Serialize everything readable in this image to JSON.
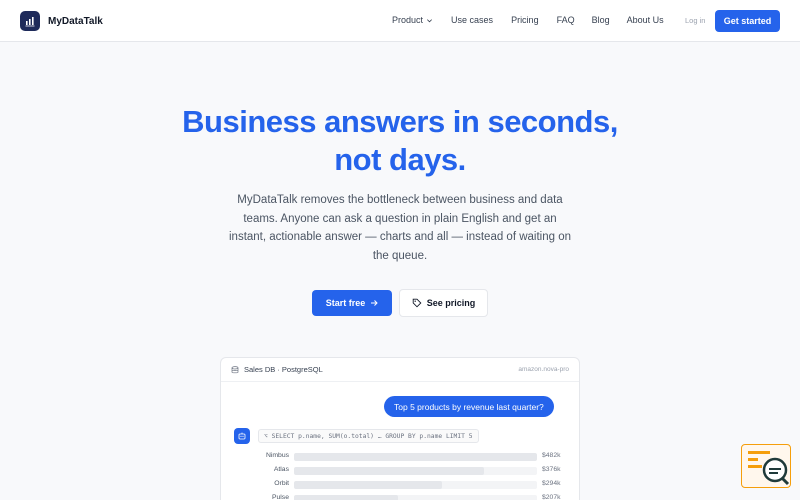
{
  "brand": {
    "name": "MyDataTalk",
    "accent": "#2563eb",
    "logo_bg": "#1e2a5a"
  },
  "nav": {
    "links": [
      {
        "label": "Product",
        "dropdown": true
      },
      {
        "label": "Use cases"
      },
      {
        "label": "Pricing"
      },
      {
        "label": "FAQ"
      },
      {
        "label": "Blog"
      },
      {
        "label": "About Us"
      }
    ],
    "login": "Log in",
    "cta": "Get started"
  },
  "hero": {
    "headline_1": "Business answers in seconds,",
    "headline_2": "not days.",
    "subtext": "MyDataTalk removes the bottleneck between business and data teams. Anyone can ask a question in plain English and get an instant, actionable answer — charts and all — instead of waiting on the queue.",
    "primary_button": "Start free",
    "secondary_button": "See pricing"
  },
  "demo": {
    "db_label": "Sales DB · PostgreSQL",
    "model": "amazon.nova-pro",
    "question": "Top 5 products by revenue last quarter?",
    "sql": "⌥ SELECT p.name, SUM(o.total) … GROUP BY p.name LIMIT 5",
    "results": [
      {
        "name": "Nimbus",
        "value_label": "$482k",
        "value": 482
      },
      {
        "name": "Atlas",
        "value_label": "$376k",
        "value": 376
      },
      {
        "name": "Orbit",
        "value_label": "$294k",
        "value": 294
      },
      {
        "name": "Pulse",
        "value_label": "$207k",
        "value": 207
      }
    ]
  },
  "widget": {
    "icon": "search-chat-icon",
    "accent": "#f59e0b"
  }
}
